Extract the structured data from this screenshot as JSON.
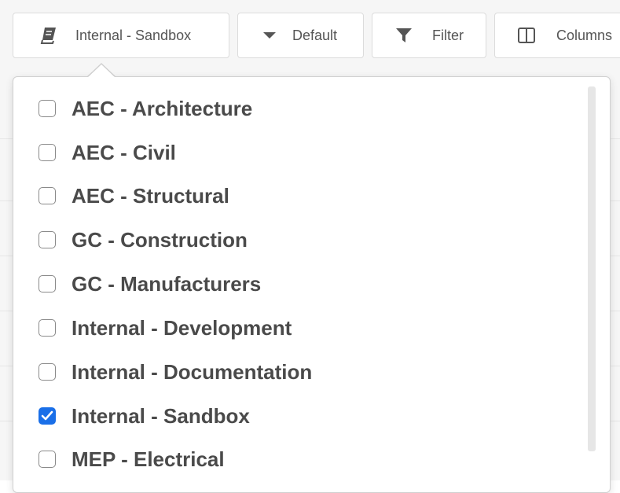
{
  "toolbar": {
    "project_label": "Internal - Sandbox",
    "default_label": "Default",
    "filter_label": "Filter",
    "columns_label": "Columns"
  },
  "dropdown": {
    "options": [
      {
        "label": "AEC - Architecture",
        "checked": false
      },
      {
        "label": "AEC - Civil",
        "checked": false
      },
      {
        "label": "AEC - Structural",
        "checked": false
      },
      {
        "label": "GC - Construction",
        "checked": false
      },
      {
        "label": "GC - Manufacturers",
        "checked": false
      },
      {
        "label": "Internal - Development",
        "checked": false
      },
      {
        "label": "Internal - Documentation",
        "checked": false
      },
      {
        "label": "Internal - Sandbox",
        "checked": true
      },
      {
        "label": "MEP - Electrical",
        "checked": false
      }
    ]
  },
  "colors": {
    "accent": "#1a6fe8",
    "text": "#4a4a4a",
    "border": "#dcdcdc"
  },
  "icons": {
    "project": "book-icon",
    "default": "caret-down-icon",
    "filter": "filter-icon",
    "columns": "columns-icon"
  }
}
